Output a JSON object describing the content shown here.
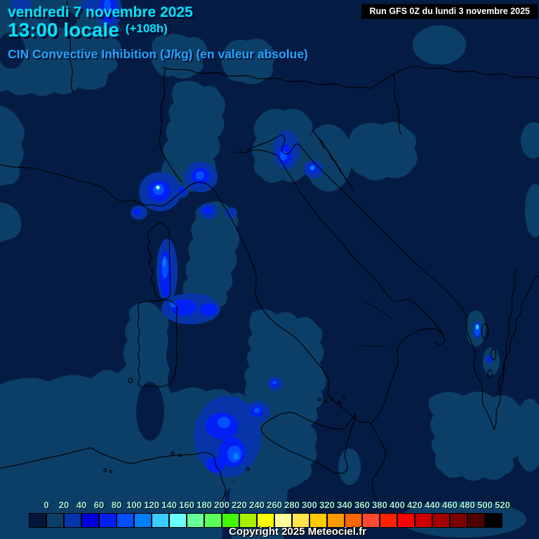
{
  "header": {
    "date_line": "vendredi 7 novembre 2025",
    "time_line": "13:00 locale",
    "offset_label": "(+108h)",
    "param_line": "CIN Convective Inhibition (J/kg) (en valeur absolue)",
    "run_label": "Run GFS 0Z du lundi 3 novembre 2025"
  },
  "footer": {
    "copyright": "Copyright 2025 Meteociel.fr"
  },
  "scale": {
    "unit": "J/kg",
    "labels": [
      "0",
      "20",
      "40",
      "60",
      "80",
      "100",
      "120",
      "140",
      "160",
      "180",
      "200",
      "220",
      "240",
      "260",
      "280",
      "300",
      "320",
      "340",
      "360",
      "380",
      "400",
      "420",
      "440",
      "460",
      "480",
      "500",
      "520"
    ],
    "colors": [
      "#03163a",
      "#0c3f68",
      "#0535a8",
      "#0100d8",
      "#0020f5",
      "#0050ff",
      "#0080ff",
      "#39ccff",
      "#6cffff",
      "#66ff99",
      "#5aff5a",
      "#44f500",
      "#aaee00",
      "#ffff00",
      "#ffff99",
      "#ffe44d",
      "#ffcc00",
      "#ff9900",
      "#ff6600",
      "#ff4830",
      "#ff2200",
      "#ff0000",
      "#cc0000",
      "#a30000",
      "#7d0000",
      "#4f0000",
      "#000000"
    ]
  },
  "colors": {
    "sea": "#041c44",
    "cin_20": "#0c3f68",
    "cin_40": "#0535a8",
    "cin_80": "#0020f5",
    "cin_100": "#0050ff",
    "cin_120": "#0080ff",
    "cin_140": "#39ccff",
    "cin_core": "#d0faff",
    "coastline": "#000000",
    "date_text": "#00e4ff",
    "param_text": "#22a4ff",
    "run_text": "#ffffff",
    "run_bg": "#000000",
    "scale_label_text": "#a4ecdf",
    "copyright_text": "#ffffff"
  }
}
